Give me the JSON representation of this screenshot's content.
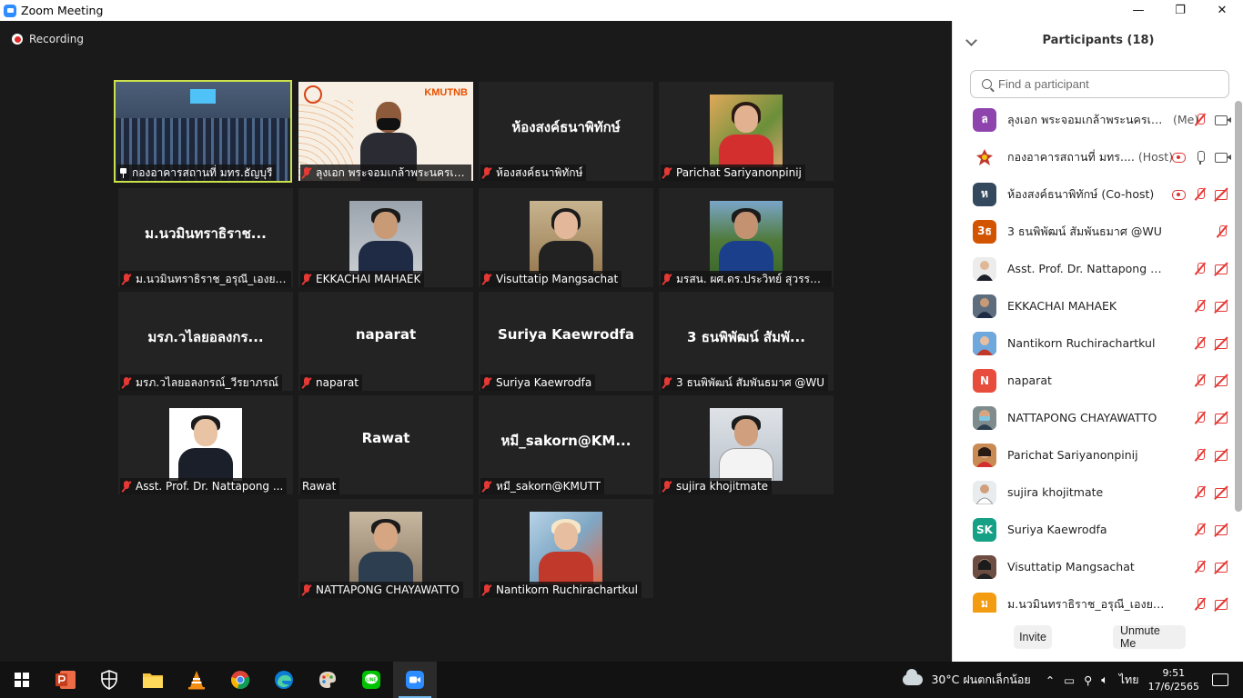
{
  "window": {
    "title": "Zoom Meeting",
    "minimize": "—",
    "restore": "❐",
    "close": "✕"
  },
  "meeting": {
    "recording_label": "Recording",
    "tiles": [
      {
        "label": "กองอาคารสถานที่ มทร.ธัญบุรี",
        "center": "",
        "pinned": true
      },
      {
        "label": "ลุงเอก พระจอมเกล้าพระนครเหนือ",
        "center": ""
      },
      {
        "label": "ห้องสงค์ธนาพิทักษ์",
        "center": "ห้องสงค์ธนาพิทักษ์"
      },
      {
        "label": "Parichat Sariyanonpinij",
        "center": ""
      },
      {
        "label": "ม.นวมินทราธิราช_อรุณี_เองยสมาก",
        "center": "ม.นวมินทราธิราช..."
      },
      {
        "label": "EKKACHAI MAHAEK",
        "center": ""
      },
      {
        "label": "Visuttatip Mangsachat",
        "center": ""
      },
      {
        "label": "มรสน. ผศ.ดร.ประวิทย์ สุวรรณรงค์",
        "center": ""
      },
      {
        "label": "มรภ.วไลยอลงกรณ์_วีรยาภรณ์",
        "center": "มรภ.วไลยอลงกร..."
      },
      {
        "label": "naparat",
        "center": "naparat"
      },
      {
        "label": "Suriya  Kaewrodfa",
        "center": "Suriya  Kaewrodfa"
      },
      {
        "label": "3 ธนพิพัฒน์ สัมพันธมาศ @WU",
        "center": "3 ธนพิพัฒน์ สัมพั..."
      },
      {
        "label": "Asst. Prof. Dr. Nattapong ...",
        "center": ""
      },
      {
        "label": "Rawat",
        "center": "Rawat"
      },
      {
        "label": "หมี_sakorn@KMUTT",
        "center": "หมี_sakorn@KM..."
      },
      {
        "label": "sujira khojitmate",
        "center": ""
      },
      {
        "label": "NATTAPONG CHAYAWATTO",
        "center": ""
      },
      {
        "label": "Nantikorn Ruchirachartkul",
        "center": ""
      }
    ],
    "kmutnb_logo": "KMUTNB"
  },
  "participants": {
    "title": "Participants (18)",
    "search_placeholder": "Find a participant",
    "items": [
      {
        "name": "ลุงเอก พระจอมเกล้าพระนครเห...",
        "suffix": "(Me)",
        "avatar": "ล",
        "color": "#8e44ad"
      },
      {
        "name": "กองอาคารสถานที่ มทร....",
        "suffix": "(Host)",
        "avatar": "",
        "color": "#ffffff"
      },
      {
        "name": "ห้องสงค์ธนาพิทักษ์ (Co-host)",
        "suffix": "",
        "avatar": "ห",
        "color": "#34495e"
      },
      {
        "name": "3 ธนพิพัฒน์ สัมพันธมาศ @WU",
        "suffix": "",
        "avatar": "3ธ",
        "color": "#d35400"
      },
      {
        "name": "Asst. Prof. Dr. Nattapong Maka...",
        "suffix": "",
        "avatar": "",
        "color": "#dcdcdc"
      },
      {
        "name": "EKKACHAI MAHAEK",
        "suffix": "",
        "avatar": "",
        "color": "#5d6d7e"
      },
      {
        "name": "Nantikorn Ruchirachartkul",
        "suffix": "",
        "avatar": "",
        "color": "#c0392b"
      },
      {
        "name": "naparat",
        "suffix": "",
        "avatar": "N",
        "color": "#e74c3c"
      },
      {
        "name": "NATTAPONG CHAYAWATTO",
        "suffix": "",
        "avatar": "",
        "color": "#7f8c8d"
      },
      {
        "name": "Parichat Sariyanonpinij",
        "suffix": "",
        "avatar": "",
        "color": "#c98b54"
      },
      {
        "name": "sujira khojitmate",
        "suffix": "",
        "avatar": "",
        "color": "#bdc3c7"
      },
      {
        "name": "Suriya  Kaewrodfa",
        "suffix": "",
        "avatar": "SK",
        "color": "#16a085"
      },
      {
        "name": "Visuttatip Mangsachat",
        "suffix": "",
        "avatar": "",
        "color": "#6d4c41"
      },
      {
        "name": "ม.นวมินทราธิราช_อรุณี_เองยสมาก",
        "suffix": "",
        "avatar": "ม",
        "color": "#f39c12"
      }
    ],
    "invite_label": "Invite",
    "unmute_label": "Unmute Me"
  },
  "taskbar": {
    "weather": "30°C  ฝนตกเล็กน้อย",
    "language": "ไทย",
    "time": "9:51",
    "date": "17/6/2565"
  }
}
